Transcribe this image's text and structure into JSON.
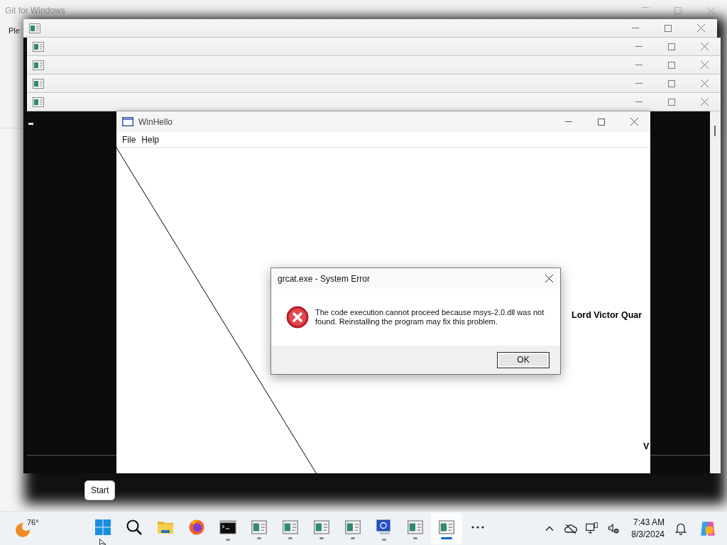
{
  "git_window": {
    "title": "Git for Windows",
    "text": "Ple"
  },
  "stacked_windows": [
    {
      "kind": "app"
    },
    {
      "kind": "app"
    },
    {
      "kind": "app"
    },
    {
      "kind": "app"
    },
    {
      "kind": "app"
    }
  ],
  "main_window": {
    "title": "WinHello",
    "menu": [
      "File",
      "Help"
    ],
    "canvas_texts": [
      "Lord Victor Quar",
      "V"
    ]
  },
  "dialog": {
    "title": "grcat.exe - System Error",
    "kind": "error",
    "message": "The code execution cannot proceed because msys-2.0.dll was not found. Reinstalling the program may fix this problem.",
    "button": "OK"
  },
  "tooltip": "Start",
  "taskbar": {
    "weather": "76°",
    "apps": [
      {
        "kind": "start",
        "running": false,
        "selected": false
      },
      {
        "kind": "search",
        "running": false,
        "selected": false
      },
      {
        "kind": "folder",
        "running": false,
        "selected": false
      },
      {
        "kind": "browser",
        "running": false,
        "selected": false
      },
      {
        "kind": "terminal",
        "running": true,
        "selected": false
      },
      {
        "kind": "app",
        "running": true,
        "selected": false
      },
      {
        "kind": "app",
        "running": true,
        "selected": false
      },
      {
        "kind": "app",
        "running": true,
        "selected": false
      },
      {
        "kind": "app",
        "running": true,
        "selected": false
      },
      {
        "kind": "monitor",
        "running": true,
        "selected": false
      },
      {
        "kind": "app",
        "running": true,
        "selected": false
      },
      {
        "kind": "app",
        "running": true,
        "selected": true
      },
      {
        "kind": "more",
        "running": false,
        "selected": false
      }
    ],
    "tray": [
      {
        "kind": "chevron"
      },
      {
        "kind": "cloud"
      },
      {
        "kind": "network"
      },
      {
        "kind": "volume"
      }
    ],
    "clock": {
      "time": "7:43 AM",
      "date": "8/3/2024"
    },
    "tray_end": [
      {
        "kind": "bell"
      },
      {
        "kind": "copilot"
      }
    ]
  }
}
